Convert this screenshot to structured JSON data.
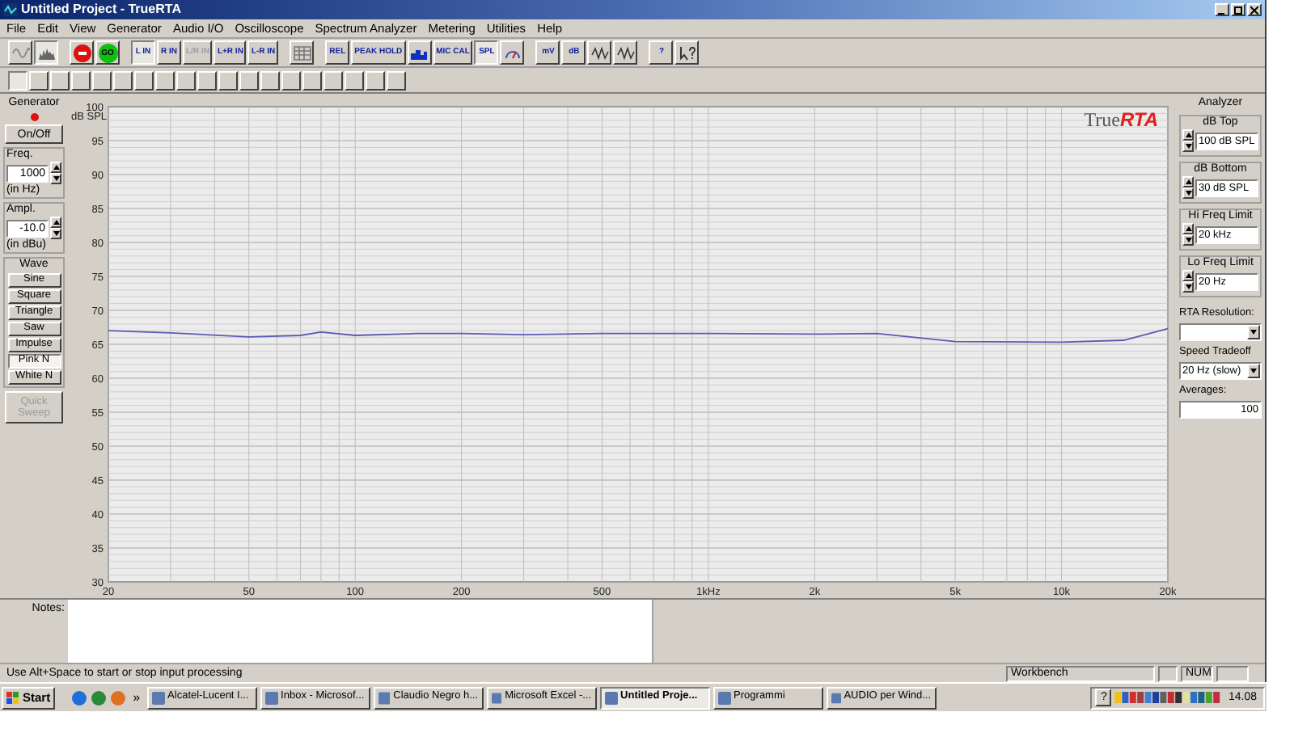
{
  "window": {
    "title": "Untitled Project - TrueRTA"
  },
  "menu": [
    "File",
    "Edit",
    "View",
    "Generator",
    "Audio I/O",
    "Oscilloscope",
    "Spectrum Analyzer",
    "Metering",
    "Utilities",
    "Help"
  ],
  "toolbar": [
    {
      "kind": "sine",
      "selected": false,
      "disabled": false
    },
    {
      "kind": "spectrum",
      "selected": true,
      "disabled": false
    },
    {
      "kind": "gap"
    },
    {
      "kind": "stop",
      "selected": false,
      "disabled": false
    },
    {
      "kind": "go",
      "label": "GO",
      "selected": false,
      "disabled": false
    },
    {
      "kind": "gap"
    },
    {
      "kind": "text",
      "label": "L IN",
      "selected": true,
      "disabled": false
    },
    {
      "kind": "text",
      "label": "R IN",
      "selected": false,
      "disabled": false
    },
    {
      "kind": "text",
      "label": "L/R IN",
      "selected": false,
      "disabled": true
    },
    {
      "kind": "text",
      "label": "L+R IN",
      "selected": false,
      "disabled": false
    },
    {
      "kind": "text",
      "label": "L-R IN",
      "selected": false,
      "disabled": false
    },
    {
      "kind": "gap"
    },
    {
      "kind": "grid",
      "selected": false,
      "disabled": false
    },
    {
      "kind": "gap"
    },
    {
      "kind": "text",
      "label": "REL",
      "selected": false,
      "disabled": false
    },
    {
      "kind": "text",
      "label": "PEAK HOLD",
      "selected": false,
      "disabled": false
    },
    {
      "kind": "bars",
      "selected": false,
      "disabled": false
    },
    {
      "kind": "text",
      "label": "MIC CAL",
      "selected": false,
      "disabled": false
    },
    {
      "kind": "text",
      "label": "SPL",
      "selected": true,
      "disabled": false
    },
    {
      "kind": "meter",
      "selected": false,
      "disabled": false
    },
    {
      "kind": "gap"
    },
    {
      "kind": "text",
      "label": "mV",
      "selected": false,
      "disabled": false
    },
    {
      "kind": "text",
      "label": "dB",
      "selected": false,
      "disabled": false
    },
    {
      "kind": "wave",
      "selected": false,
      "disabled": false
    },
    {
      "kind": "wave",
      "selected": false,
      "disabled": false
    },
    {
      "kind": "gap"
    },
    {
      "kind": "text",
      "label": "?",
      "selected": false,
      "disabled": false
    },
    {
      "kind": "help",
      "selected": false,
      "disabled": false
    }
  ],
  "memory_buttons": [
    {
      "selected": true
    },
    {
      "selected": false
    },
    {
      "selected": false
    },
    {
      "selected": false
    },
    {
      "selected": false
    },
    {
      "selected": false
    },
    {
      "selected": false
    },
    {
      "selected": false
    },
    {
      "selected": false
    },
    {
      "selected": false
    },
    {
      "selected": false
    },
    {
      "selected": false
    },
    {
      "selected": false
    },
    {
      "selected": false
    },
    {
      "selected": false
    },
    {
      "selected": false
    },
    {
      "selected": false
    },
    {
      "selected": false
    },
    {
      "selected": false
    }
  ],
  "generator": {
    "title": "Generator",
    "on_off": "On/Off",
    "freq": {
      "label": "Freq.",
      "value": "1000",
      "unit": "(in Hz)"
    },
    "ampl": {
      "label": "Ampl.",
      "value": "-10.0",
      "unit": "(in dBu)"
    },
    "wave_label": "Wave",
    "waves": [
      {
        "label": "Sine",
        "selected": false
      },
      {
        "label": "Square",
        "selected": false
      },
      {
        "label": "Triangle",
        "selected": false
      },
      {
        "label": "Saw",
        "selected": false
      },
      {
        "label": "Impulse",
        "selected": false
      },
      {
        "label": "Pink N",
        "selected": true
      },
      {
        "label": "White N",
        "selected": false
      }
    ],
    "quick_sweep": {
      "label": "Quick Sweep",
      "disabled": true
    }
  },
  "plot": {
    "logo": {
      "prefix": "True",
      "suffix": "RTA"
    },
    "y_axis_label": "dB SPL",
    "y_tick_labels": [
      "100",
      "95",
      "90",
      "85",
      "80",
      "75",
      "70",
      "65",
      "60",
      "55",
      "50",
      "45",
      "40",
      "35",
      "30"
    ],
    "x_tick_labels": [
      "20",
      "50",
      "100",
      "200",
      "500",
      "1kHz",
      "2k",
      "5k",
      "10k",
      "20k"
    ]
  },
  "analyzer": {
    "title": "Analyzer",
    "fields": [
      {
        "label": "dB Top",
        "value": "100 dB SPL"
      },
      {
        "label": "dB Bottom",
        "value": "30 dB SPL"
      },
      {
        "label": "Hi Freq Limit",
        "value": "20 kHz"
      },
      {
        "label": "Lo Freq Limit",
        "value": "20 Hz"
      }
    ],
    "rta_resolution": {
      "label": "RTA Resolution:"
    },
    "speed": {
      "label": "Speed Tradeoff",
      "value": "20 Hz (slow)"
    },
    "averages": {
      "label": "Averages:",
      "value": "100"
    }
  },
  "notes": {
    "label": "Notes:"
  },
  "status_bar": {
    "message": "Use Alt+Space to start or stop input processing",
    "panel": "Workbench",
    "num": "NUM"
  },
  "taskbar": {
    "start": "Start",
    "more": "»",
    "tasks": [
      {
        "label": "Alcatel-Lucent I...",
        "selected": false
      },
      {
        "label": "Inbox - Microsof...",
        "selected": false
      },
      {
        "label": "Claudio Negro h...",
        "selected": false
      },
      {
        "label": "Microsoft Excel -...",
        "selected": false
      },
      {
        "label": "Untitled Proje...",
        "selected": true
      },
      {
        "label": "Programmi",
        "selected": false
      },
      {
        "label": "AUDIO per Wind...",
        "selected": false
      }
    ],
    "help": "?",
    "clock": "14.08"
  }
}
